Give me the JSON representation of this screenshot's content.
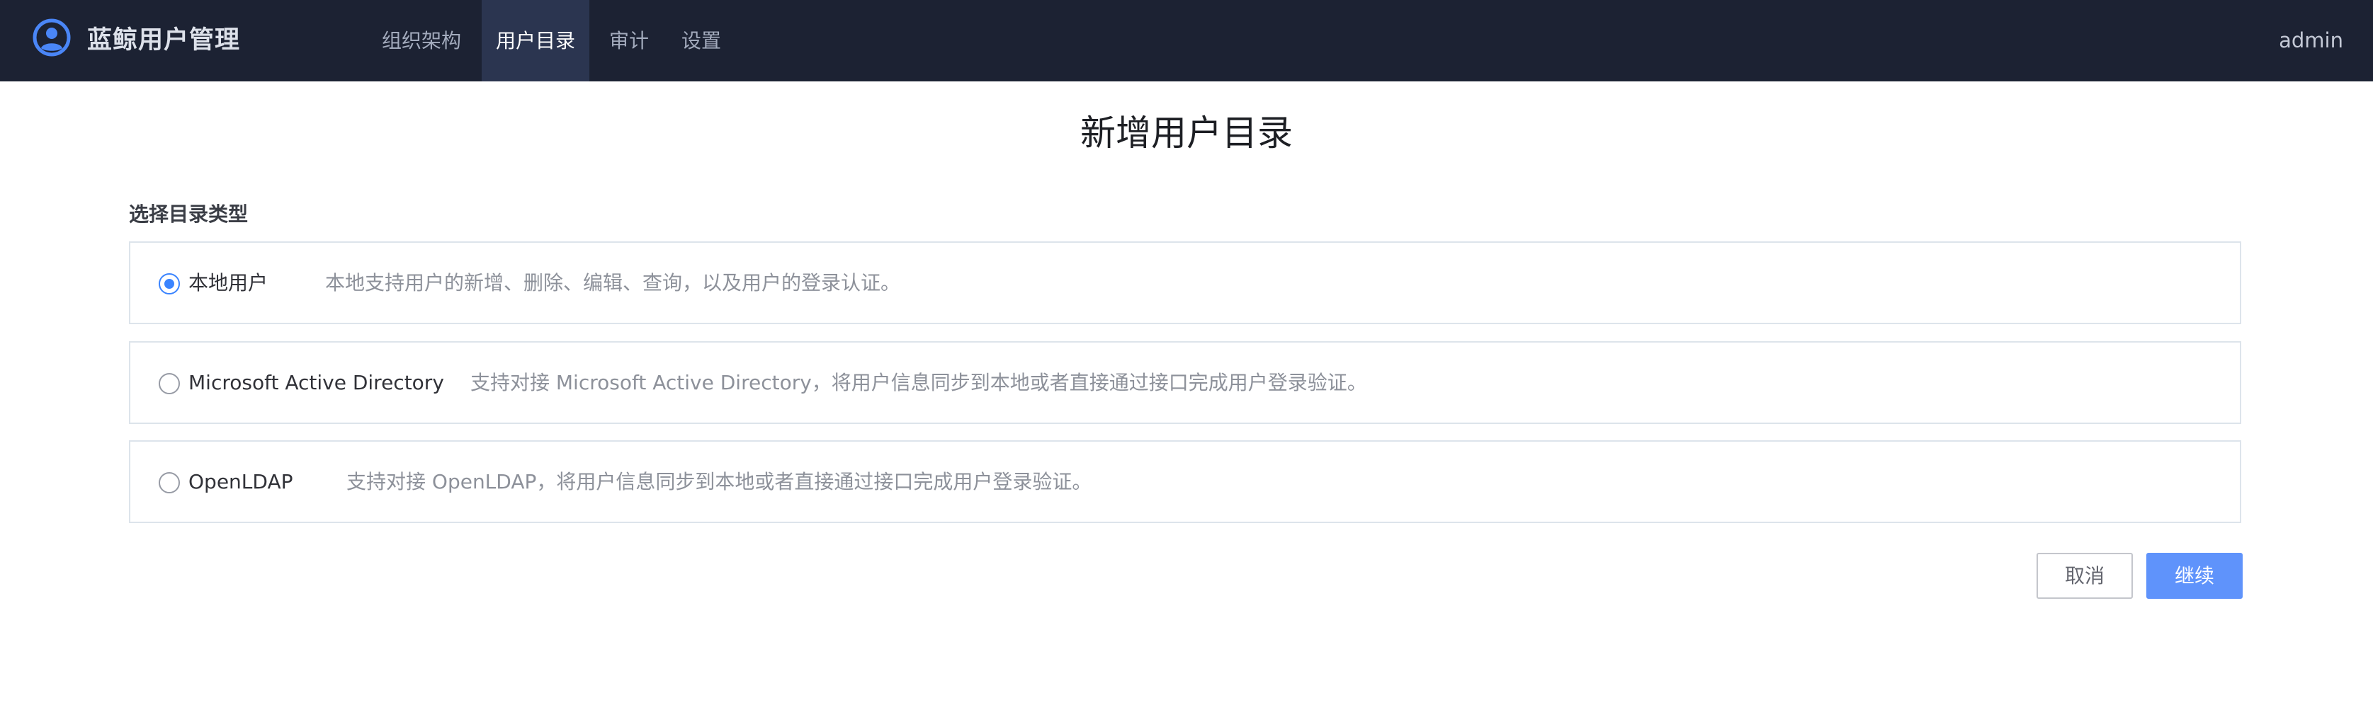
{
  "header": {
    "brand": "蓝鲸用户管理",
    "nav": [
      {
        "label": "组织架构",
        "active": false
      },
      {
        "label": "用户目录",
        "active": true
      },
      {
        "label": "审计",
        "active": false
      },
      {
        "label": "设置",
        "active": false
      }
    ],
    "user": "admin",
    "logo_icon": "user-avatar-icon"
  },
  "page": {
    "title": "新增用户目录",
    "section_label": "选择目录类型"
  },
  "options": [
    {
      "name": "本地用户",
      "description": "本地支持用户的新增、删除、编辑、查询，以及用户的登录认证。",
      "selected": true
    },
    {
      "name": "Microsoft Active Directory",
      "description": "支持对接 Microsoft Active Directory，将用户信息同步到本地或者直接通过接口完成用户登录验证。",
      "selected": false
    },
    {
      "name": "OpenLDAP",
      "description": "支持对接 OpenLDAP，将用户信息同步到本地或者直接通过接口完成用户登录验证。",
      "selected": false
    }
  ],
  "actions": {
    "cancel": "取消",
    "continue": "继续"
  },
  "colors": {
    "topbar": "#1c2233",
    "nav_active_bg": "#2b3550",
    "primary": "#5f93fb",
    "radio_checked": "#3a84ff"
  }
}
